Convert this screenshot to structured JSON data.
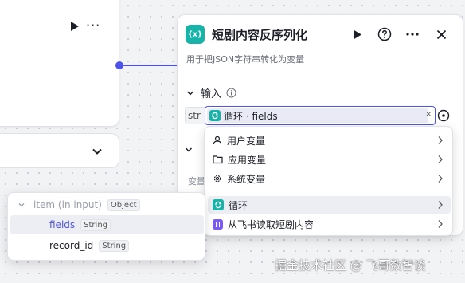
{
  "node": {
    "icon_text": "{x}",
    "title": "短剧内容反序列化",
    "description": "用于把JSON字符串转化为变量"
  },
  "input_section": {
    "label": "输入",
    "var_name": "str",
    "ref_text": "循环 · fields",
    "clear_glyph": "×"
  },
  "behind": {
    "label": "变量"
  },
  "dropdown": {
    "items": [
      {
        "label": "用户变量",
        "icon": "user-icon"
      },
      {
        "label": "应用变量",
        "icon": "folder-icon"
      },
      {
        "label": "系统变量",
        "icon": "gear-icon"
      },
      {
        "label": "循环",
        "icon": "loop-icon"
      },
      {
        "label": "从飞书读取短剧内容",
        "icon": "feishu-icon"
      }
    ]
  },
  "tree": {
    "parent": {
      "name": "item (in input)",
      "type": "Object"
    },
    "children": [
      {
        "name": "fields",
        "type": "String"
      },
      {
        "name": "record_id",
        "type": "String"
      }
    ]
  },
  "watermark": "掘金技术社区 @ 飞哥数智谈",
  "colors": {
    "accent": "#4d53e8",
    "node_teal": "#17b2a8",
    "feishu_purple": "#7a5cf0"
  }
}
